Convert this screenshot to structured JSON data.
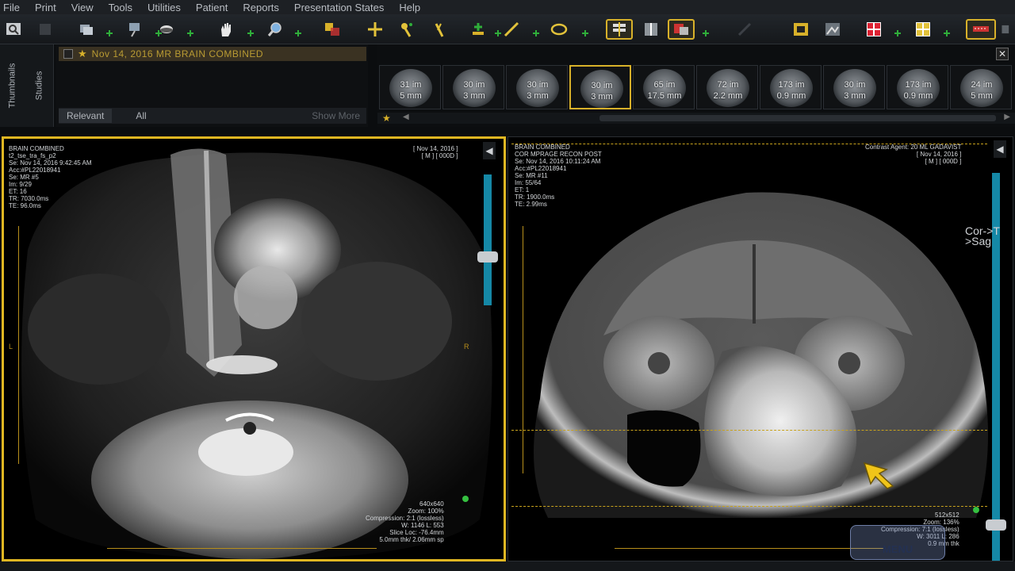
{
  "menu": [
    "File",
    "Print",
    "View",
    "Tools",
    "Utilities",
    "Patient",
    "Reports",
    "Presentation States",
    "Help"
  ],
  "sidebar": {
    "tab_thumbnails": "Thumbnails",
    "tab_studies": "Studies"
  },
  "study": {
    "header": "Nov 14, 2016  MR  BRAIN  COMBINED",
    "relevant_label": "Relevant",
    "all_label": "All",
    "show_more_label": "Show More"
  },
  "thumbnails": [
    {
      "line1": "31 im",
      "line2": "5 mm"
    },
    {
      "line1": "30 im",
      "line2": "3 mm"
    },
    {
      "line1": "30 im",
      "line2": "3 mm"
    },
    {
      "line1": "30 im",
      "line2": "3 mm"
    },
    {
      "line1": "65 im",
      "line2": "17.5 mm"
    },
    {
      "line1": "72 im",
      "line2": "2.2 mm"
    },
    {
      "line1": "173 im",
      "line2": "0.9 mm"
    },
    {
      "line1": "30 im",
      "line2": "3 mm"
    },
    {
      "line1": "173 im",
      "line2": "0.9 mm"
    },
    {
      "line1": "24 im",
      "line2": "5 mm"
    }
  ],
  "viewport_left": {
    "info_tl": "BRAIN COMBINED\nt2_tse_tra_fs_p2\nSe: Nov 14, 2016 9:42:45 AM\nAcc:#PL22018941\nSe: MR #5\nIm: 9/29\nET: 16\nTR: 7030.0ms\nTE: 96.0ms",
    "info_tr": "[ Nov 14, 2016 ]\n[ M ] [ 000D ]",
    "info_br": "640x640\nZoom: 100%\nCompression: 2:1 (lossless)\nW: 1146 L: 553\nSlice Loc: -76.4mm\n5.0mm thk/ 2.06mm sp",
    "orientation_right": "R",
    "orientation_left": "L"
  },
  "viewport_right": {
    "info_tl": "BRAIN COMBINED\nCOR MPRAGE RECON POST\nSe: Nov 14, 2016 10:11:24 AM\nAcc:#PL22018941\nSe: MR #11\nIm: 55/64\nET: 1\nTR: 1900.0ms\nTE: 2.99ms",
    "info_tr": "Contrast Agent: 20 ML GADAVIST\n[ Nov 14, 2016 ]\n[ M ] [ 000D ]",
    "info_br": "512x512\nZoom: 136%\nCompression: 7:1 (lossless)\nW: 3011 L: 286\n0.9 mm thk",
    "side_label": "Cor->T\n>Sag",
    "menu_button": "MENU"
  },
  "colors": {
    "accent": "#e0b722",
    "scroll": "#1588a6",
    "add": "#2fae3a"
  }
}
